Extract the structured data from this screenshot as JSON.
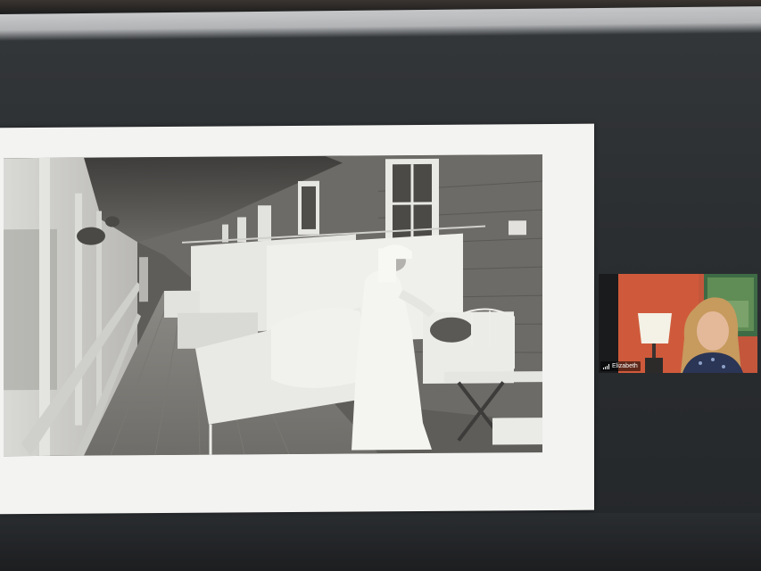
{
  "meeting": {
    "participant": {
      "name": "Elizabeth",
      "connection_icon": "signal-bars-icon"
    },
    "shared_content": {
      "kind": "slide",
      "image": "black-and-white-photo"
    }
  },
  "colors": {
    "screen_background": "#2b2e31",
    "slide_background": "#f3f3f1",
    "tile_background": "#1a1b1d",
    "label_text": "#ffffff"
  }
}
